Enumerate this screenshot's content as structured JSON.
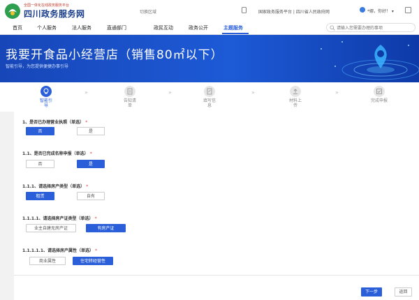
{
  "header": {
    "brand_small": "全国一体化在线政务服务平台",
    "brand_main": "四川政务服务网",
    "region_switch": "切换区域",
    "links": "国家政务服务平台 | 四川省人民政府网",
    "greeting": "*娜，你好！ ▾"
  },
  "nav": {
    "items": [
      "首页",
      "个人服务",
      "法人服务",
      "直通部门",
      "政民互动",
      "政务公开",
      "主题服务"
    ],
    "active": "主题服务",
    "search_placeholder": "请输入您需要办理的事项"
  },
  "banner": {
    "title": "我要开食品小经营店（销售80㎡以下）",
    "subtitle": "智能引导，为您提供便捷办事引导"
  },
  "steps": [
    {
      "label": "智能引\n导",
      "icon": "guide-icon",
      "active": true
    },
    {
      "label": "告知清\n单",
      "icon": "list-icon",
      "active": false
    },
    {
      "label": "填写信\n息",
      "icon": "form-icon",
      "active": false
    },
    {
      "label": "材料上\n传",
      "icon": "upload-icon",
      "active": false
    },
    {
      "label": "完成申报",
      "icon": "complete-icon",
      "active": false
    }
  ],
  "questions": [
    {
      "text": "1、是否已办理营业执照（单选）",
      "options": [
        "否",
        "是"
      ],
      "selected": 0
    },
    {
      "text": "1.1、是否已完成名称申报（单选）",
      "options": [
        "否",
        "是"
      ],
      "selected": 1
    },
    {
      "text": "1.1.1、请选择房产类型（单选）",
      "options": [
        "租赁",
        "自有"
      ],
      "selected": 0
    },
    {
      "text": "1.1.1.1、请选择房产证类型（单选）",
      "options": [
        "业主自建无房产证",
        "有房产证"
      ],
      "selected": 1
    },
    {
      "text": "1.1.1.1.1、请选择房产属性（单选）",
      "options": [
        "商业属性",
        "住宅转经营性"
      ],
      "selected": 1
    }
  ],
  "required_mark": "*",
  "buttons": {
    "next": "下一步",
    "back": "返回"
  },
  "colors": {
    "accent": "#2b5fd9",
    "required": "#e53935",
    "brand": "#1a3e8c"
  }
}
